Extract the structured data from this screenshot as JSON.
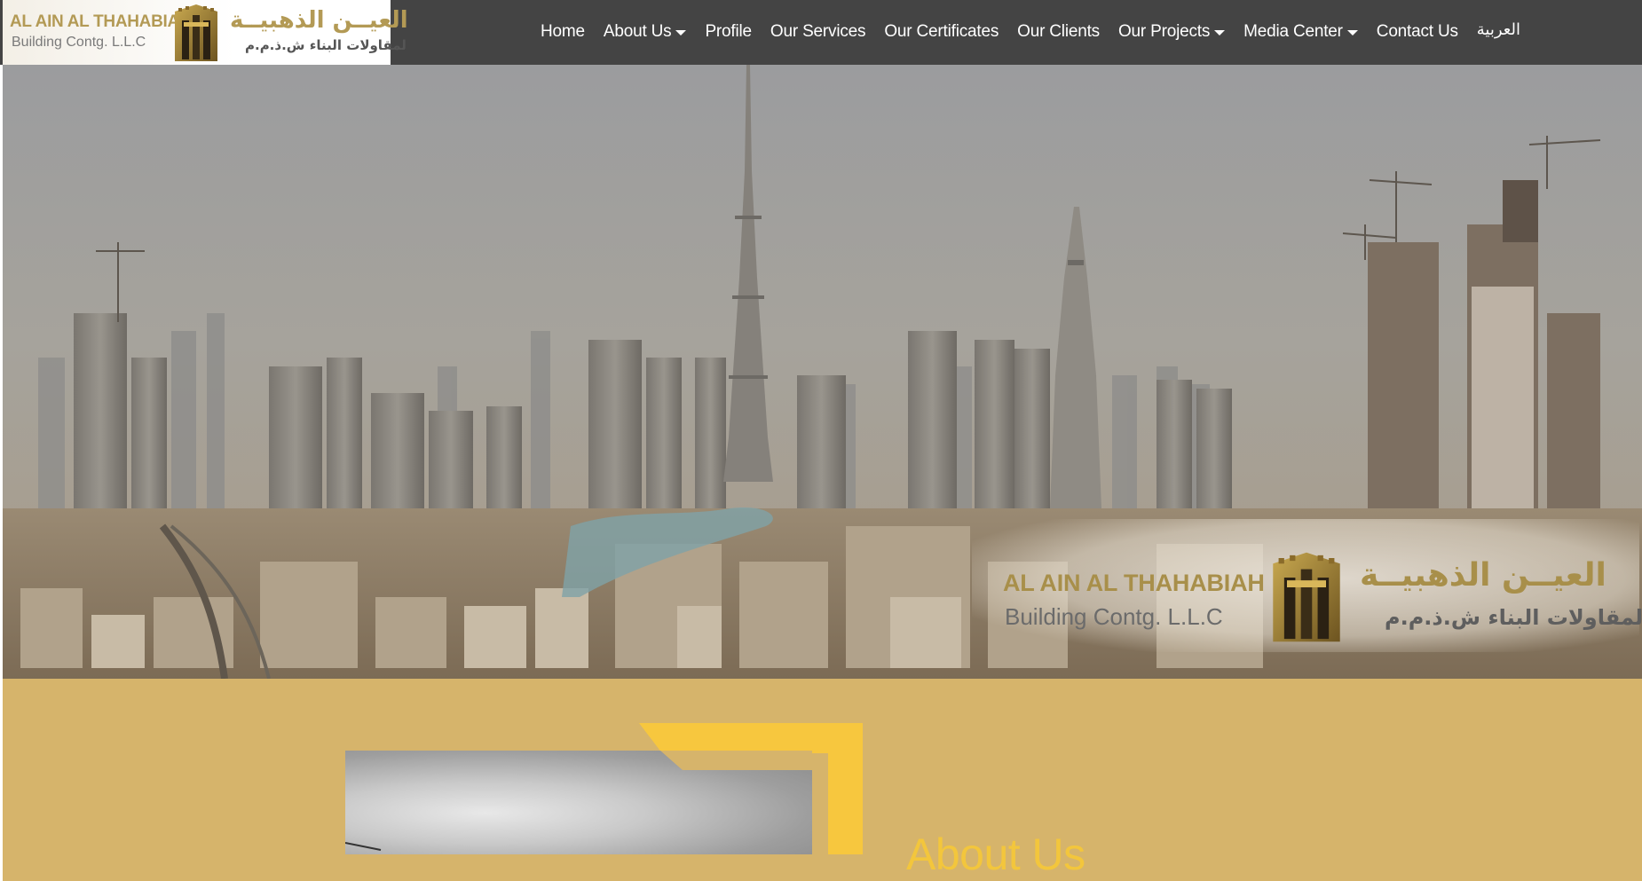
{
  "brand": {
    "name_en_line1": "AL AIN AL THAHABIAH",
    "name_en_line2": "Building Contg. L.L.C",
    "name_ar_line1": "العيــن الذهبيــة",
    "name_ar_line2": "لمقاولات البناء ش.ذ.م.م",
    "emblem_icon": "building-emblem-icon",
    "gold": "#b39a55"
  },
  "nav": {
    "items": [
      {
        "label": "Home",
        "dropdown": false
      },
      {
        "label": "About Us",
        "dropdown": true
      },
      {
        "label": "Profile",
        "dropdown": false
      },
      {
        "label": "Our Services",
        "dropdown": false
      },
      {
        "label": "Our Certificates",
        "dropdown": false
      },
      {
        "label": "Our Clients",
        "dropdown": false
      },
      {
        "label": "Our Projects",
        "dropdown": true
      },
      {
        "label": "Media Center",
        "dropdown": true
      },
      {
        "label": "Contact Us",
        "dropdown": false
      },
      {
        "label": "العربية",
        "dropdown": false
      }
    ],
    "background": "#444444",
    "text_color": "#ffffff"
  },
  "hero": {
    "image_subject": "city-skyline-image",
    "watermark": {
      "name_en_line1": "AL AIN AL THAHABIAH",
      "name_en_line2": "Building Contg. L.L.C",
      "name_ar_line1": "العيــن الذهبيــة",
      "name_ar_line2": "لمقاولات البناء ش.ذ.م.م"
    }
  },
  "about": {
    "title": "About Us",
    "section_background": "#d6b46b",
    "accent": "#f7c73e"
  }
}
